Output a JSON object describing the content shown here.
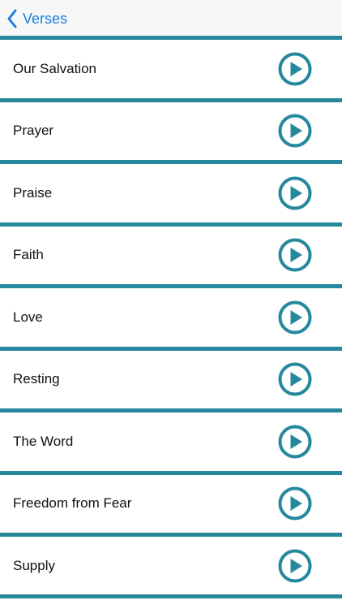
{
  "navbar": {
    "back_label": "Verses",
    "back_icon": "chevron-left-icon",
    "accent_color": "#1a7fe0"
  },
  "list": {
    "divider_color": "#26889c",
    "play_icon": "play-circle-icon",
    "items": [
      {
        "label": "Our Salvation"
      },
      {
        "label": "Prayer"
      },
      {
        "label": "Praise"
      },
      {
        "label": "Faith"
      },
      {
        "label": "Love"
      },
      {
        "label": "Resting"
      },
      {
        "label": "The Word"
      },
      {
        "label": "Freedom from Fear"
      },
      {
        "label": "Supply"
      }
    ]
  }
}
